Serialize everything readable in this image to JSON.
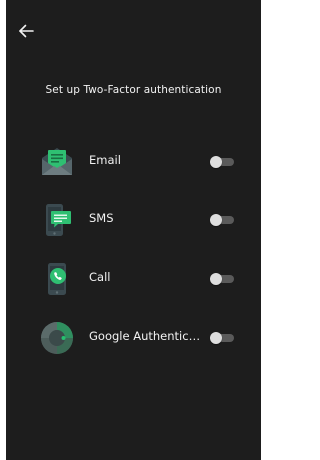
{
  "header": {
    "back_icon": "arrow-left-icon",
    "title": "Set up Two-Factor authentication"
  },
  "methods": [
    {
      "label": "Email",
      "icon": "email-envelope-icon",
      "enabled": false
    },
    {
      "label": "SMS",
      "icon": "sms-phone-icon",
      "enabled": false
    },
    {
      "label": "Call",
      "icon": "call-phone-icon",
      "enabled": false
    },
    {
      "label": "Google Authenticat...",
      "icon": "google-authenticator-icon",
      "enabled": false
    }
  ],
  "colors": {
    "background": "#1d1d1d",
    "text": "#f2f2f2",
    "accent_green": "#25c16f",
    "toggle_off_track": "#5a5a5a",
    "toggle_off_thumb": "#dedede"
  }
}
